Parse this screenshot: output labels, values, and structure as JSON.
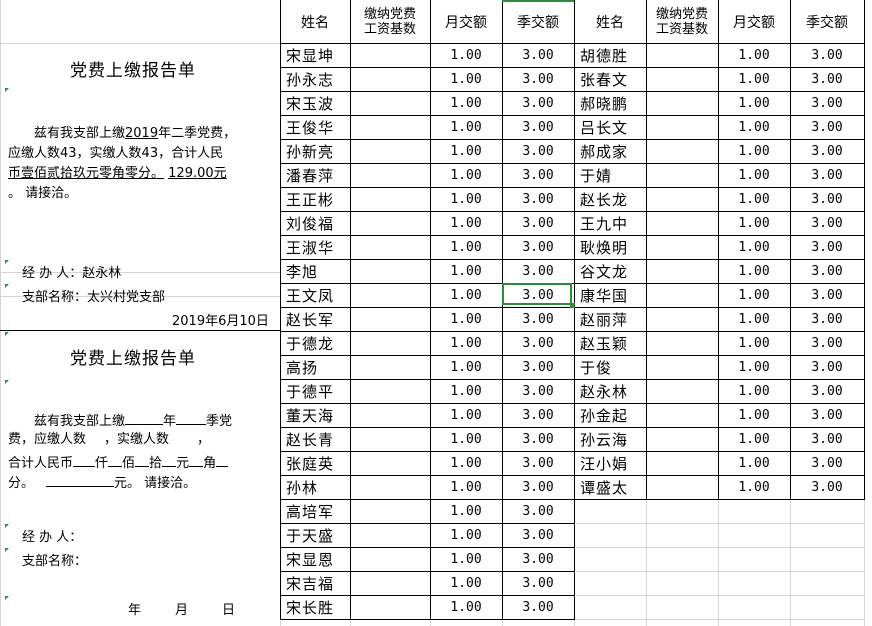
{
  "colors": {
    "grid": "#d4d4d4",
    "border": "#000000",
    "selection": "#2e8b3e"
  },
  "header": {
    "name": "姓名",
    "base_line1": "缴纳党费",
    "base_line2": "工资基数",
    "monthly": "月交额",
    "quarterly": "季交额"
  },
  "form1": {
    "title": "党费上缴报告单",
    "p1_a": "兹有我支部上缴",
    "p1_year": "2019",
    "p1_b": "年二季党费，",
    "p2": "应缴人数43，实缴人数43，合计人民",
    "p3_a": "币壹佰贰拾玖元零角零分。",
    "p3_amount": "129.00元",
    "p4": "。 请接洽。",
    "handler": "经 办 人：赵永林",
    "branch": "支部名称：太兴村党支部",
    "date": "2019年6月10日"
  },
  "form2": {
    "title": "党费上缴报告单",
    "p1_a": "兹有我支部上缴",
    "p1_b": "年",
    "p1_c": "季党",
    "p2_a": "费，应缴人数",
    "p2_b": "，实缴人数",
    "p2_c": "，",
    "p3_a": "合计人民币",
    "p3_b": "仟",
    "p3_c": "佰",
    "p3_d": "拾",
    "p3_e": "元",
    "p3_f": "角",
    "p4_a": "分。",
    "p4_b": "元。 请接洽。",
    "handler": "经 办 人：",
    "branch": "支部名称：",
    "date_year": "年",
    "date_month": "月",
    "date_day": "日"
  },
  "left_rows": [
    {
      "name": "宋显坤",
      "monthly": "1.00",
      "quarterly": "3.00"
    },
    {
      "name": "孙永志",
      "monthly": "1.00",
      "quarterly": "3.00"
    },
    {
      "name": "宋玉波",
      "monthly": "1.00",
      "quarterly": "3.00"
    },
    {
      "name": "王俊华",
      "monthly": "1.00",
      "quarterly": "3.00"
    },
    {
      "name": "孙新亮",
      "monthly": "1.00",
      "quarterly": "3.00"
    },
    {
      "name": "潘春萍",
      "monthly": "1.00",
      "quarterly": "3.00"
    },
    {
      "name": "王正彬",
      "monthly": "1.00",
      "quarterly": "3.00"
    },
    {
      "name": "刘俊福",
      "monthly": "1.00",
      "quarterly": "3.00"
    },
    {
      "name": "王淑华",
      "monthly": "1.00",
      "quarterly": "3.00"
    },
    {
      "name": "李旭",
      "monthly": "1.00",
      "quarterly": "3.00"
    },
    {
      "name": "王文凤",
      "monthly": "1.00",
      "quarterly": "3.00"
    },
    {
      "name": "赵长军",
      "monthly": "1.00",
      "quarterly": "3.00"
    },
    {
      "name": "于德龙",
      "monthly": "1.00",
      "quarterly": "3.00"
    },
    {
      "name": "高扬",
      "monthly": "1.00",
      "quarterly": "3.00"
    },
    {
      "name": "于德平",
      "monthly": "1.00",
      "quarterly": "3.00"
    },
    {
      "name": "董天海",
      "monthly": "1.00",
      "quarterly": "3.00"
    },
    {
      "name": "赵长青",
      "monthly": "1.00",
      "quarterly": "3.00"
    },
    {
      "name": "张庭英",
      "monthly": "1.00",
      "quarterly": "3.00"
    },
    {
      "name": "孙林",
      "monthly": "1.00",
      "quarterly": "3.00"
    },
    {
      "name": "高培军",
      "monthly": "1.00",
      "quarterly": "3.00"
    },
    {
      "name": "于天盛",
      "monthly": "1.00",
      "quarterly": "3.00"
    },
    {
      "name": "宋显恩",
      "monthly": "1.00",
      "quarterly": "3.00"
    },
    {
      "name": "宋吉福",
      "monthly": "1.00",
      "quarterly": "3.00"
    },
    {
      "name": "宋长胜",
      "monthly": "1.00",
      "quarterly": "3.00"
    }
  ],
  "right_rows": [
    {
      "name": "胡德胜",
      "monthly": "1.00",
      "quarterly": "3.00"
    },
    {
      "name": "张春文",
      "monthly": "1.00",
      "quarterly": "3.00"
    },
    {
      "name": "郝晓鹏",
      "monthly": "1.00",
      "quarterly": "3.00"
    },
    {
      "name": "吕长文",
      "monthly": "1.00",
      "quarterly": "3.00"
    },
    {
      "name": "郝成家",
      "monthly": "1.00",
      "quarterly": "3.00"
    },
    {
      "name": "于婧",
      "monthly": "1.00",
      "quarterly": "3.00"
    },
    {
      "name": "赵长龙",
      "monthly": "1.00",
      "quarterly": "3.00"
    },
    {
      "name": "王九中",
      "monthly": "1.00",
      "quarterly": "3.00"
    },
    {
      "name": "耿焕明",
      "monthly": "1.00",
      "quarterly": "3.00"
    },
    {
      "name": "谷文龙",
      "monthly": "1.00",
      "quarterly": "3.00"
    },
    {
      "name": "康华国",
      "monthly": "1.00",
      "quarterly": "3.00"
    },
    {
      "name": "赵丽萍",
      "monthly": "1.00",
      "quarterly": "3.00"
    },
    {
      "name": "赵玉颖",
      "monthly": "1.00",
      "quarterly": "3.00"
    },
    {
      "name": "于俊",
      "monthly": "1.00",
      "quarterly": "3.00"
    },
    {
      "name": "赵永林",
      "monthly": "1.00",
      "quarterly": "3.00"
    },
    {
      "name": "孙金起",
      "monthly": "1.00",
      "quarterly": "3.00"
    },
    {
      "name": "孙云海",
      "monthly": "1.00",
      "quarterly": "3.00"
    },
    {
      "name": "汪小娟",
      "monthly": "1.00",
      "quarterly": "3.00"
    },
    {
      "name": "谭盛太",
      "monthly": "1.00",
      "quarterly": "3.00"
    }
  ]
}
